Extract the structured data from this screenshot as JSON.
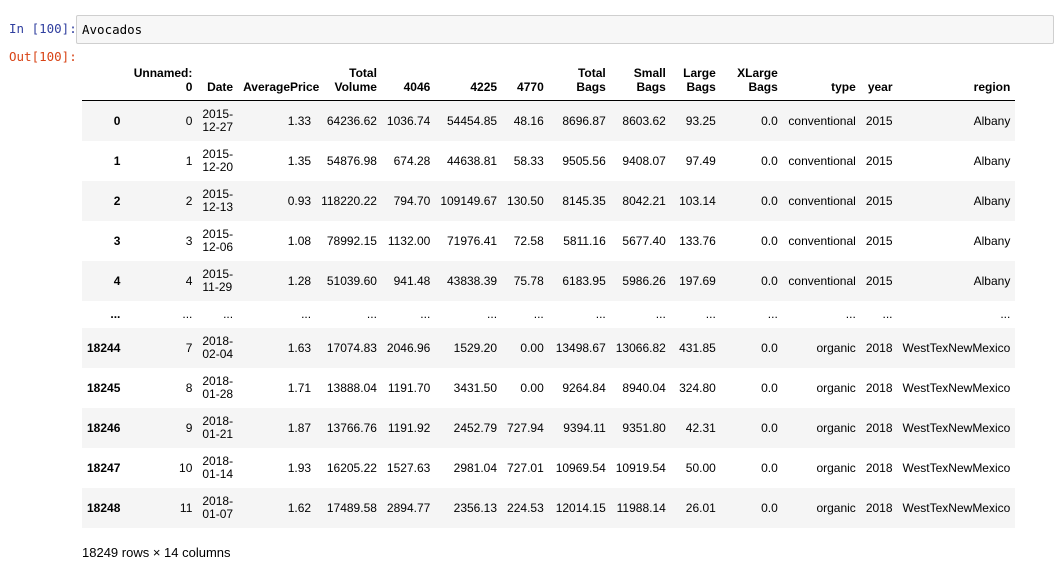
{
  "prompts": {
    "input": "In [100]:",
    "output": "Out[100]:"
  },
  "input_cell": {
    "code": "Avocados"
  },
  "columns": [
    "",
    "Unnamed: 0",
    "Date",
    "AveragePrice",
    "Total Volume",
    "4046",
    "4225",
    "4770",
    "Total Bags",
    "Small Bags",
    "Large Bags",
    "XLarge Bags",
    "type",
    "year",
    "region"
  ],
  "columns_display": [
    [
      "",
      ""
    ],
    [
      "Unnamed:",
      "0"
    ],
    [
      "Date",
      ""
    ],
    [
      "AveragePrice",
      ""
    ],
    [
      "Total",
      "Volume"
    ],
    [
      "4046",
      ""
    ],
    [
      "4225",
      ""
    ],
    [
      "4770",
      ""
    ],
    [
      "Total",
      "Bags"
    ],
    [
      "Small",
      "Bags"
    ],
    [
      "Large",
      "Bags"
    ],
    [
      "XLarge",
      "Bags"
    ],
    [
      "type",
      ""
    ],
    [
      "year",
      ""
    ],
    [
      "region",
      ""
    ]
  ],
  "rows": [
    {
      "index": "0",
      "cells": [
        "0",
        [
          "2015-",
          "12-27"
        ],
        "1.33",
        "64236.62",
        "1036.74",
        "54454.85",
        "48.16",
        "8696.87",
        "8603.62",
        "93.25",
        "0.0",
        "conventional",
        "2015",
        "Albany"
      ]
    },
    {
      "index": "1",
      "cells": [
        "1",
        [
          "2015-",
          "12-20"
        ],
        "1.35",
        "54876.98",
        "674.28",
        "44638.81",
        "58.33",
        "9505.56",
        "9408.07",
        "97.49",
        "0.0",
        "conventional",
        "2015",
        "Albany"
      ]
    },
    {
      "index": "2",
      "cells": [
        "2",
        [
          "2015-",
          "12-13"
        ],
        "0.93",
        "118220.22",
        "794.70",
        "109149.67",
        "130.50",
        "8145.35",
        "8042.21",
        "103.14",
        "0.0",
        "conventional",
        "2015",
        "Albany"
      ]
    },
    {
      "index": "3",
      "cells": [
        "3",
        [
          "2015-",
          "12-06"
        ],
        "1.08",
        "78992.15",
        "1132.00",
        "71976.41",
        "72.58",
        "5811.16",
        "5677.40",
        "133.76",
        "0.0",
        "conventional",
        "2015",
        "Albany"
      ]
    },
    {
      "index": "4",
      "cells": [
        "4",
        [
          "2015-",
          "11-29"
        ],
        "1.28",
        "51039.60",
        "941.48",
        "43838.39",
        "75.78",
        "6183.95",
        "5986.26",
        "197.69",
        "0.0",
        "conventional",
        "2015",
        "Albany"
      ]
    },
    {
      "index": "...",
      "ellipsis": true,
      "cells": [
        "...",
        "...",
        "...",
        "...",
        "...",
        "...",
        "...",
        "...",
        "...",
        "...",
        "...",
        "...",
        "...",
        "..."
      ]
    },
    {
      "index": "18244",
      "cells": [
        "7",
        [
          "2018-",
          "02-04"
        ],
        "1.63",
        "17074.83",
        "2046.96",
        "1529.20",
        "0.00",
        "13498.67",
        "13066.82",
        "431.85",
        "0.0",
        "organic",
        "2018",
        "WestTexNewMexico"
      ]
    },
    {
      "index": "18245",
      "cells": [
        "8",
        [
          "2018-",
          "01-28"
        ],
        "1.71",
        "13888.04",
        "1191.70",
        "3431.50",
        "0.00",
        "9264.84",
        "8940.04",
        "324.80",
        "0.0",
        "organic",
        "2018",
        "WestTexNewMexico"
      ]
    },
    {
      "index": "18246",
      "cells": [
        "9",
        [
          "2018-",
          "01-21"
        ],
        "1.87",
        "13766.76",
        "1191.92",
        "2452.79",
        "727.94",
        "9394.11",
        "9351.80",
        "42.31",
        "0.0",
        "organic",
        "2018",
        "WestTexNewMexico"
      ]
    },
    {
      "index": "18247",
      "cells": [
        "10",
        [
          "2018-",
          "01-14"
        ],
        "1.93",
        "16205.22",
        "1527.63",
        "2981.04",
        "727.01",
        "10969.54",
        "10919.54",
        "50.00",
        "0.0",
        "organic",
        "2018",
        "WestTexNewMexico"
      ]
    },
    {
      "index": "18248",
      "cells": [
        "11",
        [
          "2018-",
          "01-07"
        ],
        "1.62",
        "17489.58",
        "2894.77",
        "2356.13",
        "224.53",
        "12014.15",
        "11988.14",
        "26.01",
        "0.0",
        "organic",
        "2018",
        "WestTexNewMexico"
      ]
    }
  ],
  "footer": "18249 rows × 14 columns"
}
